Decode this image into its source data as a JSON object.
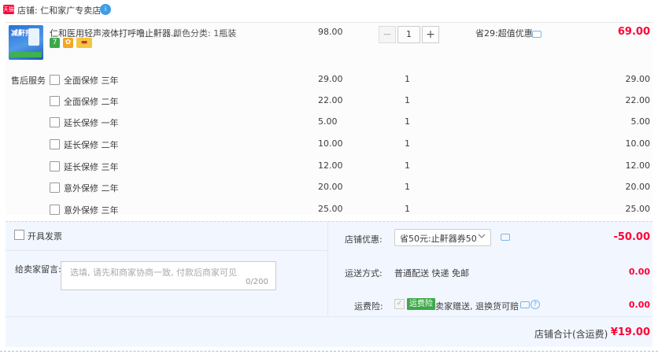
{
  "shop": {
    "badge": "天猫",
    "label": "店铺: 仁和家广专卖店"
  },
  "item": {
    "title": "仁和医用轻声液体打呼噜止鼾器...",
    "sku": "颜色分类: 1瓶装",
    "price": "98.00",
    "quantity": "1",
    "qty_minus": "−",
    "qty_plus": "+",
    "discount": "省29:超值优惠",
    "total": "69.00",
    "icons": [
      "seven-day-return-icon",
      "guarantee-icon",
      "card-payment-icon"
    ],
    "thumb_text": "减鼾打鼾"
  },
  "services": {
    "label": "售后服务",
    "rows": [
      {
        "name": "全面保修 三年",
        "price": "29.00",
        "qty": "1",
        "total": "29.00"
      },
      {
        "name": "全面保修 二年",
        "price": "22.00",
        "qty": "1",
        "total": "22.00"
      },
      {
        "name": "延长保修 一年",
        "price": "5.00",
        "qty": "1",
        "total": "5.00"
      },
      {
        "name": "延长保修 二年",
        "price": "10.00",
        "qty": "1",
        "total": "10.00"
      },
      {
        "name": "延长保修 三年",
        "price": "12.00",
        "qty": "1",
        "total": "12.00"
      },
      {
        "name": "意外保修 二年",
        "price": "20.00",
        "qty": "1",
        "total": "20.00"
      },
      {
        "name": "意外保修 三年",
        "price": "25.00",
        "qty": "1",
        "total": "25.00"
      }
    ]
  },
  "invoice": {
    "label": "开具发票"
  },
  "memo": {
    "label": "给卖家留言:",
    "placeholder": "选填, 请先和商家协商一致, 付款后商家可见",
    "count": "0/200"
  },
  "coupon": {
    "label": "店铺优惠:",
    "selected": "省50元:止鼾器券50",
    "amount": "-50.00"
  },
  "shipping": {
    "label": "运送方式:",
    "value": "普通配送 快递 免邮",
    "amount": "0.00"
  },
  "insurance": {
    "label": "运费险:",
    "badge": "运费险",
    "desc": "卖家赠送, 退换货可赔",
    "amount": "0.00"
  },
  "summary": {
    "label": "店铺合计(含运费)",
    "amount": "¥19.00"
  },
  "colors": {
    "accent_red": "#ff0036",
    "link_blue": "#3d9ee6",
    "insurance_green": "#3fa84a"
  }
}
